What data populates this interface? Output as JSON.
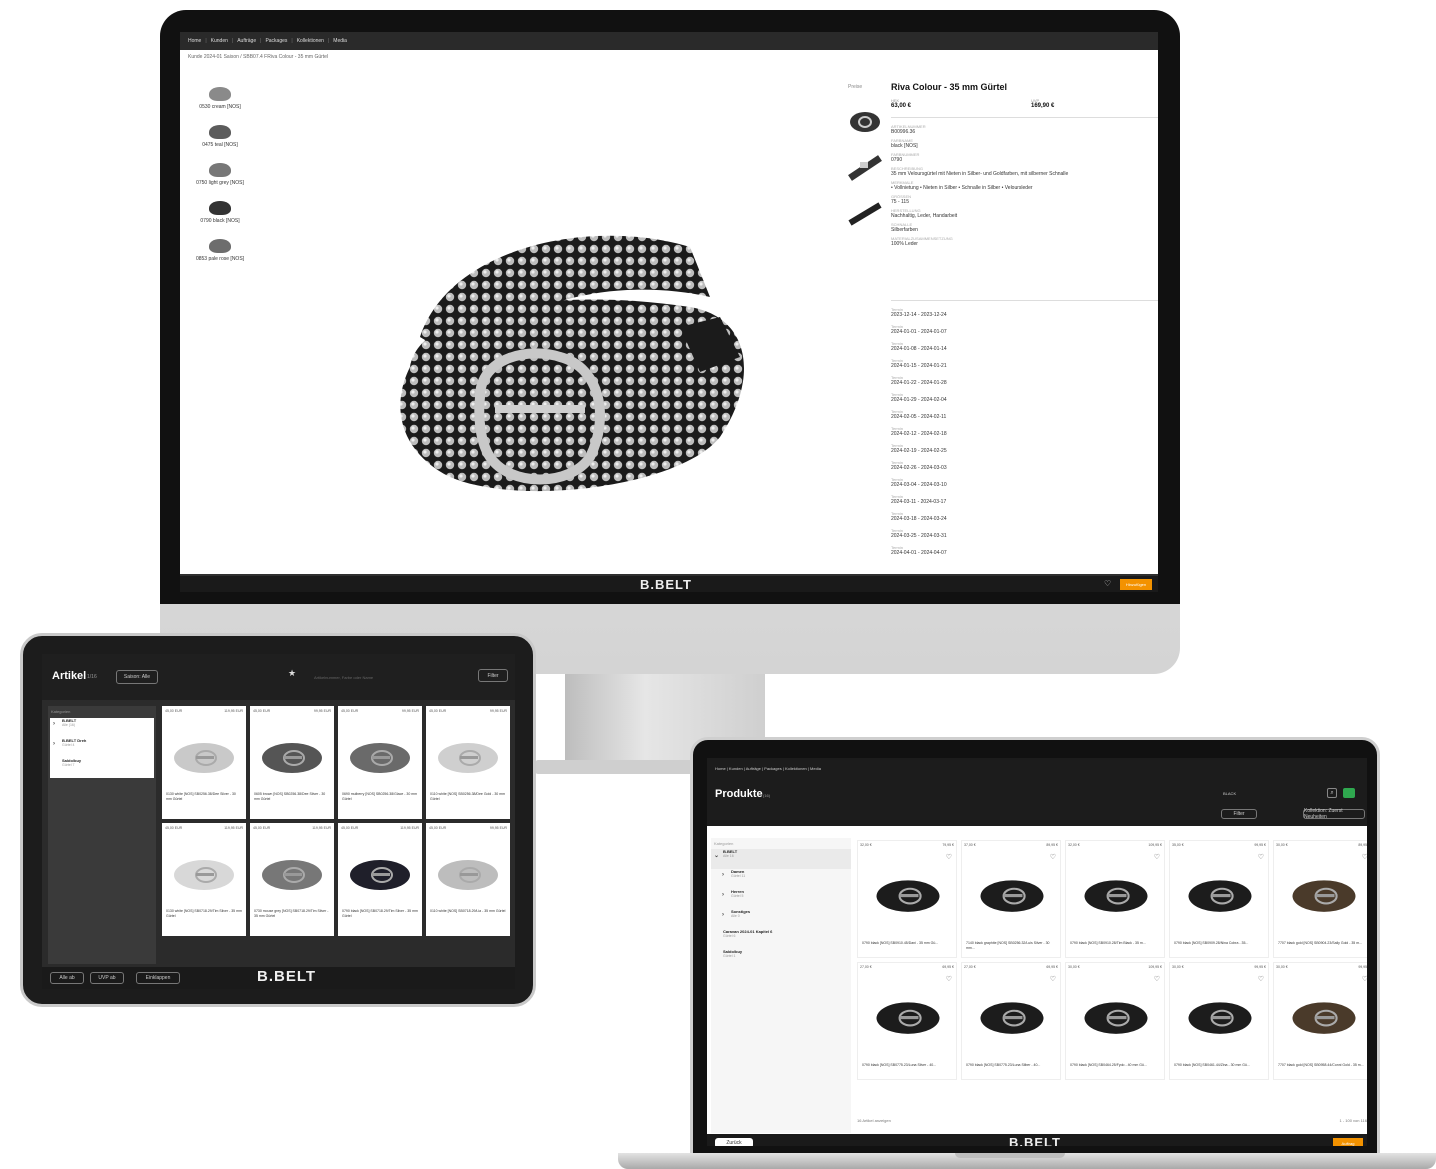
{
  "brand": {
    "logo_text": "B.BELT",
    "accent_color": "#f39200"
  },
  "desktop": {
    "nav": [
      "Home",
      "Kunden",
      "Aufträge",
      "Packages",
      "Kollektionen",
      "Media"
    ],
    "breadcrumb": "Kunde 2024-01 Saison / SBB07.4 FRiva Colour - 35 mm Gürtel",
    "variants": [
      "0530 cream [NOS]",
      "0475 teal [NOS]",
      "0750 light grey [NOS]",
      "0790 black [NOS]",
      "0853 pale rose [NOS]"
    ],
    "product_title": "Riva Colour - 35 mm Gürtel",
    "price_label_left": "Preise",
    "ek_label": "HEK",
    "ek_value": "63,00 €",
    "uvp_label": "UVP",
    "uvp_value": "169,90 €",
    "attributes": [
      {
        "key": "ARTIKELNUMMER",
        "value": "B00996.36"
      },
      {
        "key": "FARBNAME",
        "value": "black [NOS]"
      },
      {
        "key": "FARBNUMMER",
        "value": "0790"
      },
      {
        "key": "BESCHREIBUNG",
        "value": "35 mm Veloursgürtel mit Nieten in Silber- und Goldfarben, mit silberner Schnalle"
      },
      {
        "key": "MERKMALE",
        "value": "• Vollnietung • Nieten in Silber • Schnalle in Silber • Veloursleder"
      },
      {
        "key": "GRÖSSEN",
        "value": "75 - 115"
      },
      {
        "key": "HERSTELLUNG",
        "value": "Nachhaltig, Leder, Handarbeit"
      },
      {
        "key": "SCHNALLE",
        "value": "Silberfarben"
      },
      {
        "key": "MATERIALZUSAMMENSETZUNG",
        "value": "100% Leder"
      }
    ],
    "dates": [
      {
        "key": "Termin",
        "value": "2023-12-14 - 2023-12-24"
      },
      {
        "key": "Termin",
        "value": "2024-01-01 - 2024-01-07"
      },
      {
        "key": "Termin",
        "value": "2024-01-08 - 2024-01-14"
      },
      {
        "key": "Termin",
        "value": "2024-01-15 - 2024-01-21"
      },
      {
        "key": "Termin",
        "value": "2024-01-22 - 2024-01-28"
      },
      {
        "key": "Termin",
        "value": "2024-01-29 - 2024-02-04"
      },
      {
        "key": "Termin",
        "value": "2024-02-05 - 2024-02-11"
      },
      {
        "key": "Termin",
        "value": "2024-02-12 - 2024-02-18"
      },
      {
        "key": "Termin",
        "value": "2024-02-19 - 2024-02-25"
      },
      {
        "key": "Termin",
        "value": "2024-02-26 - 2024-03-03"
      },
      {
        "key": "Termin",
        "value": "2024-03-04 - 2024-03-10"
      },
      {
        "key": "Termin",
        "value": "2024-03-11 - 2024-03-17"
      },
      {
        "key": "Termin",
        "value": "2024-03-18 - 2024-03-24"
      },
      {
        "key": "Termin",
        "value": "2024-03-25 - 2024-03-31"
      },
      {
        "key": "Termin",
        "value": "2024-04-01 - 2024-04-07"
      }
    ],
    "add_button": "Hinzufügen"
  },
  "tablet": {
    "title": "Artikel",
    "count": "1/16",
    "season_pill": "Saison: Alle",
    "filter_pill": "Filter",
    "search_placeholder": "Artikelnummer, Farbe oder Name",
    "categories_label": "Kategorien",
    "categories": [
      {
        "name": "B.BELT",
        "sub": "Alle (16)"
      },
      {
        "name": "B.BELT Dreh",
        "sub": "Gürtel 4"
      },
      {
        "name": "Saldo/buy",
        "sub": "Gürtel 7"
      }
    ],
    "products": [
      {
        "ek": "45,00 EUR",
        "uvp": "119,95 EUR",
        "name": "0130 white [NOS] SB0256.38/Dee Silver - 30 mm Gürtel"
      },
      {
        "ek": "45,00 EUR",
        "uvp": "99,95 EUR",
        "name": "0605 brown [NOS] SB0256.38/Dee Silver - 30 mm Gürtel"
      },
      {
        "ek": "45,00 EUR",
        "uvp": "99,95 EUR",
        "name": "0690 mulberry [NOS] SB0256.38/Glace - 30 mm Gürtel"
      },
      {
        "ek": "45,00 EUR",
        "uvp": "99,95 EUR",
        "name": "0110 white [NOS] SB0256.38/Dee Gold - 30 mm Gürtel"
      },
      {
        "ek": "45,00 EUR",
        "uvp": "119,95 EUR",
        "name": "0130 white [NOS] SB0718.29/Tim Silver - 35 mm Gürtel"
      },
      {
        "ek": "45,00 EUR",
        "uvp": "119,95 EUR",
        "name": "0730 mouse grey [NOS] SB0718.29/Tim Silver - 35 mm Gürtel"
      },
      {
        "ek": "45,00 EUR",
        "uvp": "119,95 EUR",
        "name": "0790 black [NOS] SB0718.29/Tim Silver - 35 mm Gürtel"
      },
      {
        "ek": "45,00 EUR",
        "uvp": "99,95 EUR",
        "name": "0110 white [NOS] SB0718.29/Lia - 35 mm Gürtel"
      }
    ],
    "footer_buttons": [
      "Alle ab",
      "UVP ab",
      "Einklappen"
    ]
  },
  "laptop": {
    "nav": "Home | Kunden | Aufträge | Packages | Kollektionen | Media",
    "title": "Produkte",
    "count": "(16)",
    "search_value": "BLACK",
    "filter_pill": "Filter",
    "sort_pill": "Kollektion: Zuerst Neuheiten",
    "categories_label": "Kategorien",
    "categories": [
      {
        "name": "B.BELT",
        "sub": "Alle 16"
      },
      {
        "name": "Damen",
        "sub": "Gürtel 11"
      },
      {
        "name": "Herren",
        "sub": "Gürtel 5"
      },
      {
        "name": "Sonstiges",
        "sub": "Alle 0"
      },
      {
        "name": "Caravan 2024-01 Kapitel 6",
        "sub": "Gürtel 6"
      },
      {
        "name": "Saldo/buy",
        "sub": "Gürtel 1"
      }
    ],
    "products": [
      {
        "ek": "32,00 €",
        "uvp": "79,95 €",
        "name": "0790 black [NOS] SB0910.45/Dani - 35 mm Gü..."
      },
      {
        "ek": "37,00 €",
        "uvp": "89,95 €",
        "name": "7140 black graphite [NOS] SB0256.32/Luis Silver - 30 mm..."
      },
      {
        "ek": "32,00 €",
        "uvp": "109,95 €",
        "name": "0790 black [NOS] SB0910.28/Tim Black - 35 m..."
      },
      {
        "ek": "35,00 €",
        "uvp": "99,95 €",
        "name": "0790 black [NOS] SB0909.28/Nina Cobra - 35..."
      },
      {
        "ek": "30,00 €",
        "uvp": "89,95 €",
        "name": "7707 black gold [NOS] SB0904.23/Sally Gold - 35 m..."
      },
      {
        "ek": "27,00 €",
        "uvp": "69,95 €",
        "name": "0790 black [NOS] SB0775.23/Luna Silver - 40..."
      },
      {
        "ek": "27,00 €",
        "uvp": "69,95 €",
        "name": "0790 black [NOS] SB0775.23/Luna Silber - 40..."
      },
      {
        "ek": "30,00 €",
        "uvp": "109,95 €",
        "name": "0790 black [NOS] SB0464.25/Fydo - 40 mm Gü..."
      },
      {
        "ek": "30,00 €",
        "uvp": "99,95 €",
        "name": "0790 black [NOS] SB0461.44/Zina - 30 mm Gü..."
      },
      {
        "ek": "30,00 €",
        "uvp": "99,95 €",
        "name": "7707 black gold [NOS] SB0958.44/Conni Gold - 35 m..."
      }
    ],
    "pager_left": "16 Artikel anzeigen",
    "pager_right": "1 - 100 von 116",
    "back_button": "Zurück",
    "order_button": "Auftrag"
  }
}
